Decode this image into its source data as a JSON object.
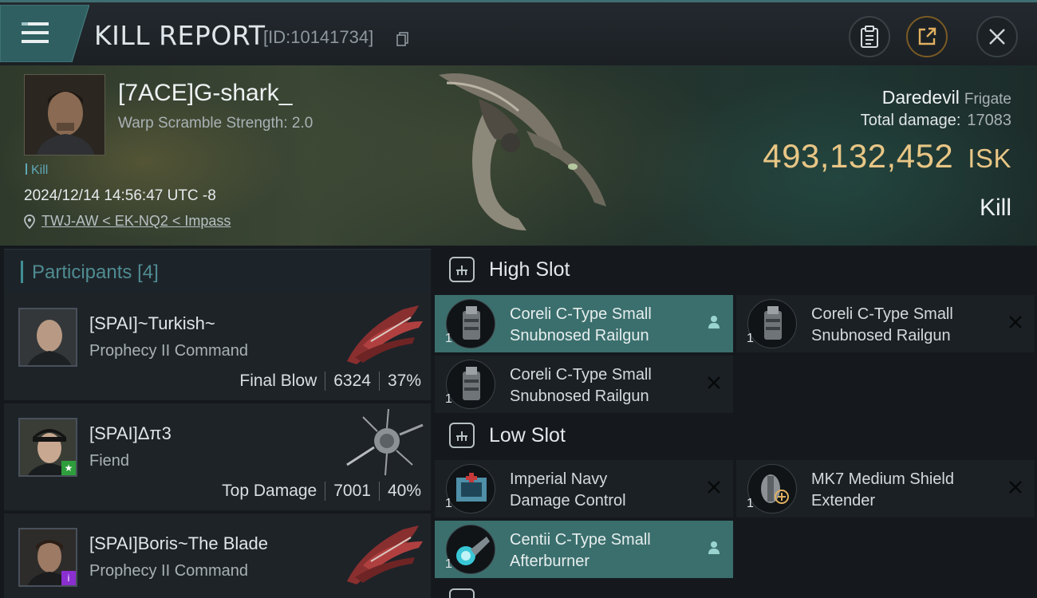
{
  "header": {
    "title": "KILL REPORT",
    "report_id": "[ID:10141734]"
  },
  "victim": {
    "name": "[7ACE]G-shark_",
    "warp_scramble": "Warp Scramble Strength: 2.0",
    "tag": "Kill",
    "datetime": "2024/12/14 14:56:47 UTC -8",
    "location": "TWJ-AW < EK-NQ2 < Impass",
    "ship_name": "Daredevil",
    "ship_class": "Frigate",
    "total_damage_label": "Total damage:",
    "total_damage": "17083",
    "isk_value": "493,132,452",
    "isk_unit": "ISK",
    "result": "Kill"
  },
  "participants": {
    "title": "Participants",
    "count": "[4]",
    "items": [
      {
        "name": "[SPAI]~Turkish~",
        "ship": "Prophecy II Command",
        "label": "Final Blow",
        "damage": "6324",
        "percent": "37%"
      },
      {
        "name": "[SPAI]Δπ3",
        "ship": "Fiend",
        "label": "Top Damage",
        "damage": "7001",
        "percent": "40%"
      },
      {
        "name": "[SPAI]Boris~The Blade",
        "ship": "Prophecy II Command",
        "label": "",
        "damage": "",
        "percent": ""
      }
    ]
  },
  "fitting": {
    "high_slot_title": "High Slot",
    "low_slot_title": "Low Slot",
    "high_modules": [
      {
        "qty": "1",
        "name_line1": "Coreli C-Type Small",
        "name_line2": "Snubnosed Railgun"
      },
      {
        "qty": "1",
        "name_line1": "Coreli C-Type Small",
        "name_line2": "Snubnosed Railgun"
      },
      {
        "qty": "1",
        "name_line1": "Coreli C-Type Small",
        "name_line2": "Snubnosed Railgun"
      }
    ],
    "low_modules": [
      {
        "qty": "1",
        "name_line1": "Imperial Navy",
        "name_line2": "Damage Control"
      },
      {
        "qty": "1",
        "name_line1": "MK7 Medium Shield",
        "name_line2": "Extender"
      },
      {
        "qty": "1",
        "name_line1": "Centii C-Type Small",
        "name_line2": "Afterburner"
      }
    ]
  },
  "colors": {
    "accent_teal": "#3b6f6d",
    "isk_gold": "#e8c685",
    "badge_green": "#2e9e3c",
    "badge_purple": "#8a2fd0"
  }
}
